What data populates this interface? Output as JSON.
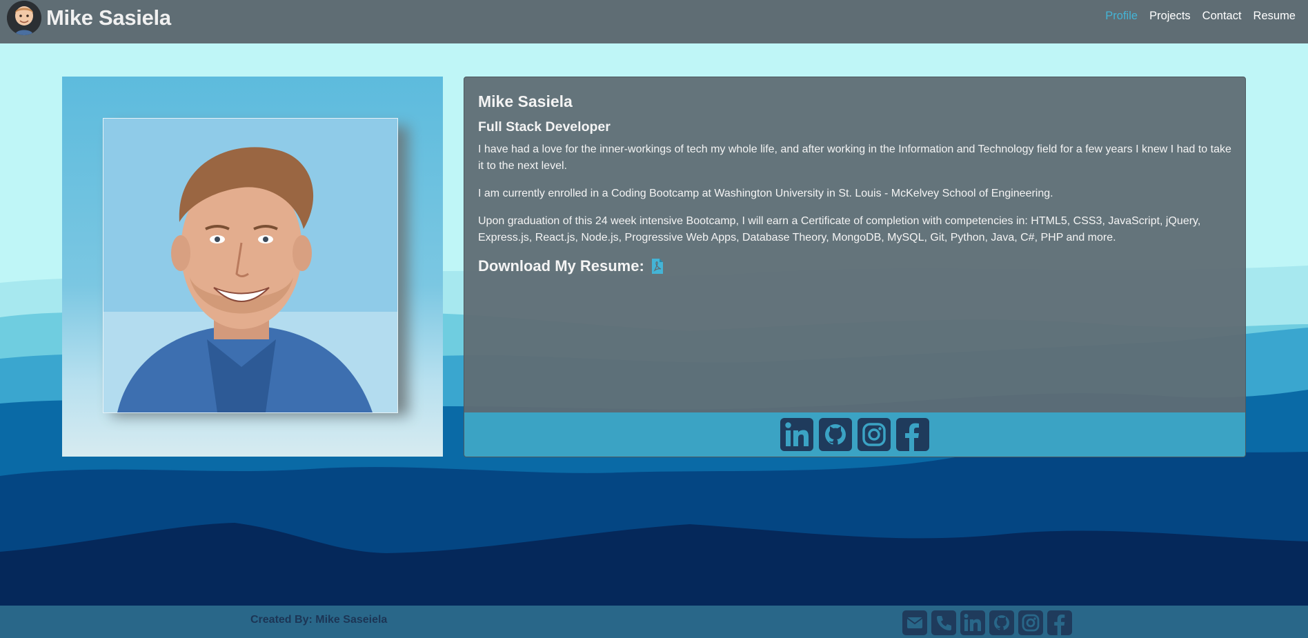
{
  "header": {
    "brand_name": "Mike Sasiela",
    "nav": [
      {
        "label": "Profile",
        "active": true
      },
      {
        "label": "Projects",
        "active": false
      },
      {
        "label": "Contact",
        "active": false
      },
      {
        "label": "Resume",
        "active": false
      }
    ]
  },
  "profile": {
    "name": "Mike Sasiela",
    "title": "Full Stack Developer",
    "paragraphs": [
      "I have had a love for the inner-workings of tech my whole life, and after working in the Information and Technology field for a few years I knew I had to take it to the next level.",
      "I am currently enrolled in a Coding Bootcamp at Washington University in St. Louis - McKelvey School of Engineering.",
      "Upon graduation of this 24 week intensive Bootcamp, I will earn a Certificate of completion with competencies in: HTML5, CSS3, JavaScript, jQuery, Express.js, React.js, Node.js, Progressive Web Apps, Database Theory, MongoDB, MySQL, Git, Python, Java, C#, PHP and more."
    ],
    "download_label": "Download My Resume:",
    "download_icon": "file-pdf-icon",
    "social_icons": [
      "linkedin-icon",
      "github-icon",
      "instagram-icon",
      "facebook-icon"
    ]
  },
  "footer": {
    "credit": "Created By: Mike Saseiela",
    "icons": [
      "envelope-icon",
      "phone-icon",
      "linkedin-icon",
      "github-icon",
      "instagram-icon",
      "facebook-icon"
    ]
  },
  "colors": {
    "navbar": "#5f6d74",
    "accent": "#44b4d6",
    "card_footer": "#3ba3c4",
    "page_footer": "#296789",
    "icon_dark": "#1f3b5c",
    "sky": "#bff6f7"
  }
}
